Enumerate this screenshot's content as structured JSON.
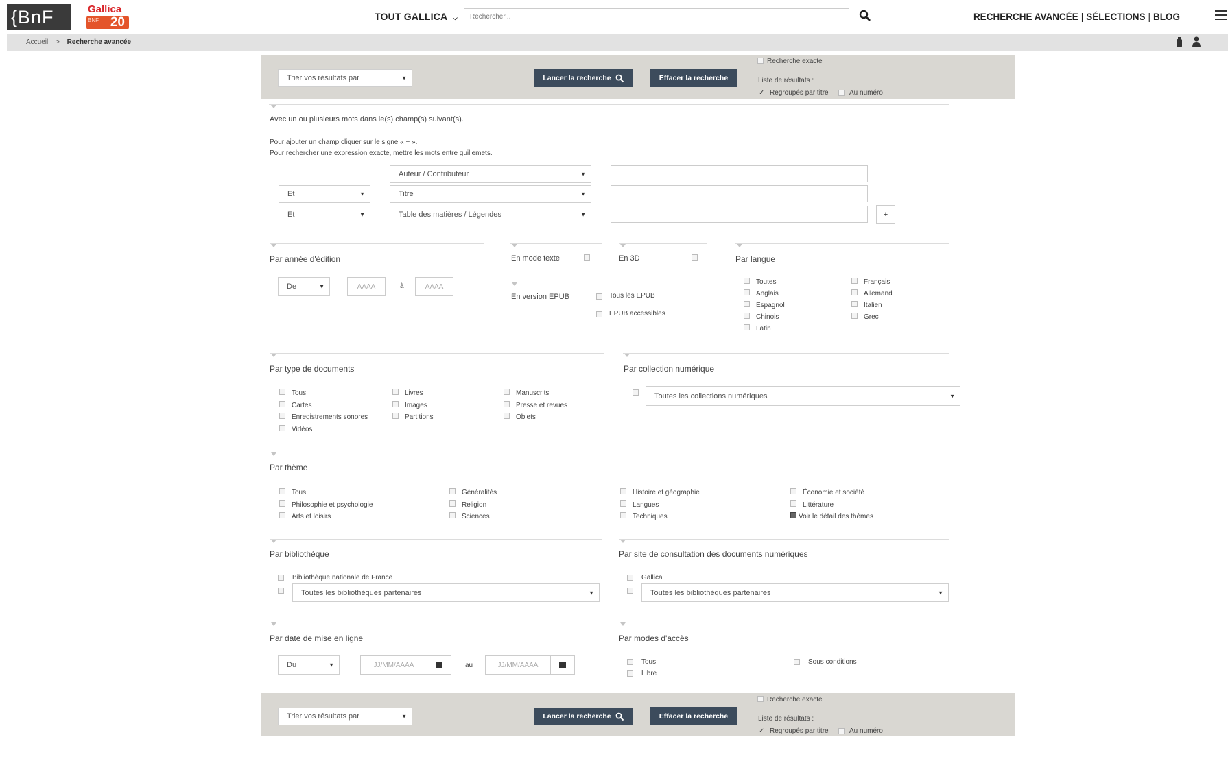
{
  "header": {
    "logo_bnf": "{BnF",
    "logo_gallica": "Gallica",
    "logo_gallica_sub": "20",
    "logo_gallica_mini": "BNF",
    "scope_label": "TOUT GALLICA",
    "search_placeholder": "Rechercher...",
    "nav": {
      "advanced": "RECHERCHE AVANCÉE",
      "selections": "SÉLECTIONS",
      "blog": "BLOG"
    },
    "sep": "|"
  },
  "breadcrumb": {
    "home": "Accueil",
    "sep": ">",
    "current": "Recherche avancée"
  },
  "toolbar": {
    "sort_label": "Trier vos résultats par",
    "search_button": "Lancer la recherche",
    "clear_button": "Effacer la recherche",
    "exact_label": "Recherche exacte",
    "results_label": "Liste de résultats :",
    "grouped_label": "Regroupés par titre",
    "by_number_label": "Au numéro"
  },
  "fields": {
    "intro": "Avec un ou plusieurs mots dans le(s) champ(s) suivant(s).",
    "help1": "Pour ajouter un champ cliquer sur le signe « + ».",
    "help2": "Pour rechercher une expression exacte, mettre les mots entre guillemets.",
    "rows": [
      {
        "operator": "",
        "field": "Auteur / Contributeur"
      },
      {
        "operator": "Et",
        "field": "Titre"
      },
      {
        "operator": "Et",
        "field": "Table des matières / Légendes"
      }
    ],
    "add_label": "+"
  },
  "year": {
    "heading": "Par année d'édition",
    "from": "De",
    "placeholder_from": "AAAA",
    "and_label": "à",
    "placeholder_to": "AAAA"
  },
  "text_mode": {
    "label": "En mode texte"
  },
  "three_d": {
    "label": "En 3D"
  },
  "epub": {
    "label": "En version EPUB",
    "all": "Tous les EPUB",
    "accessible": "EPUB accessibles"
  },
  "language": {
    "heading": "Par langue",
    "col1": [
      "Toutes",
      "Anglais",
      "Espagnol",
      "Chinois",
      "Latin"
    ],
    "col2": [
      "Français",
      "Allemand",
      "Italien",
      "Grec"
    ]
  },
  "doctype": {
    "heading": "Par type de documents",
    "col1": [
      "Tous",
      "Cartes",
      "Enregistrements sonores",
      "Vidéos"
    ],
    "col2": [
      "Livres",
      "Images",
      "Partitions"
    ],
    "col3": [
      "Manuscrits",
      "Presse et revues",
      "Objets"
    ]
  },
  "collection": {
    "heading": "Par collection numérique",
    "select": "Toutes les collections numériques"
  },
  "theme": {
    "heading": "Par thème",
    "col1": [
      "Tous",
      "Philosophie et psychologie",
      "Arts et loisirs"
    ],
    "col2": [
      "Généralités",
      "Religion",
      "Sciences"
    ],
    "col3": [
      "Histoire et géographie",
      "Langues",
      "Techniques"
    ],
    "col4": [
      "Économie et société",
      "Littérature",
      "Voir le détail des thèmes"
    ]
  },
  "library": {
    "heading": "Par bibliothèque",
    "bnf": "Bibliothèque nationale de France",
    "select": "Toutes les bibliothèques partenaires"
  },
  "site": {
    "heading": "Par site de consultation des documents numériques",
    "gallica": "Gallica",
    "select": "Toutes les bibliothèques partenaires"
  },
  "online_date": {
    "heading": "Par date de mise en ligne",
    "from": "Du",
    "placeholder_from": "JJ/MM/AAAA",
    "and_label": "au",
    "placeholder_to": "JJ/MM/AAAA"
  },
  "access": {
    "heading": "Par modes d'accès",
    "all": "Tous",
    "free": "Libre",
    "conditions": "Sous conditions"
  },
  "colors": {
    "band": "#d9d7d2",
    "button": "#3c4b5c",
    "crumb_bar": "#e2e2e2",
    "logo_dark": "#3a3a3a",
    "logo_red": "#d9262a"
  }
}
